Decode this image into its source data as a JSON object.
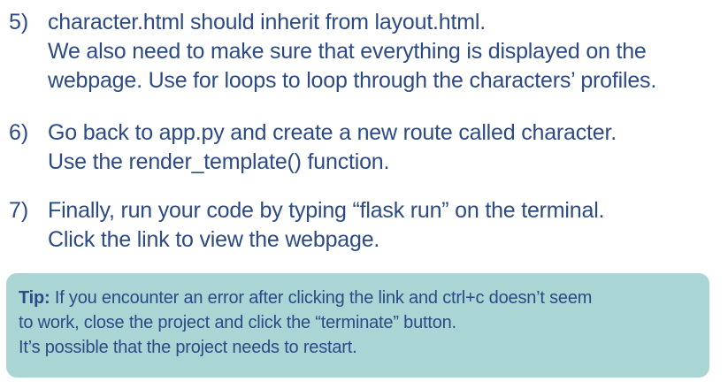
{
  "steps": [
    {
      "number": "5)",
      "lines": [
        "character.html should inherit from layout.html.",
        "We also need to make sure that everything is displayed on the",
        "webpage. Use for loops to loop through the characters’ profiles."
      ]
    },
    {
      "number": "6)",
      "lines": [
        "Go back to app.py and create a new route called character.",
        "Use the render_template() function."
      ]
    },
    {
      "number": "7)",
      "lines": [
        "Finally, run your code by typing “flask run” on the terminal.",
        "Click the link to view the webpage."
      ]
    }
  ],
  "tip": {
    "label": "Tip:",
    "line1_rest": " If you encounter an error after clicking the link and ctrl+c doesn’t seem",
    "line2": "to work, close the project and click the “terminate” button.",
    "line3": "It’s possible that the project needs to restart."
  },
  "colors": {
    "text": "#2b4a86",
    "tip_background": "#a9d6d4"
  }
}
